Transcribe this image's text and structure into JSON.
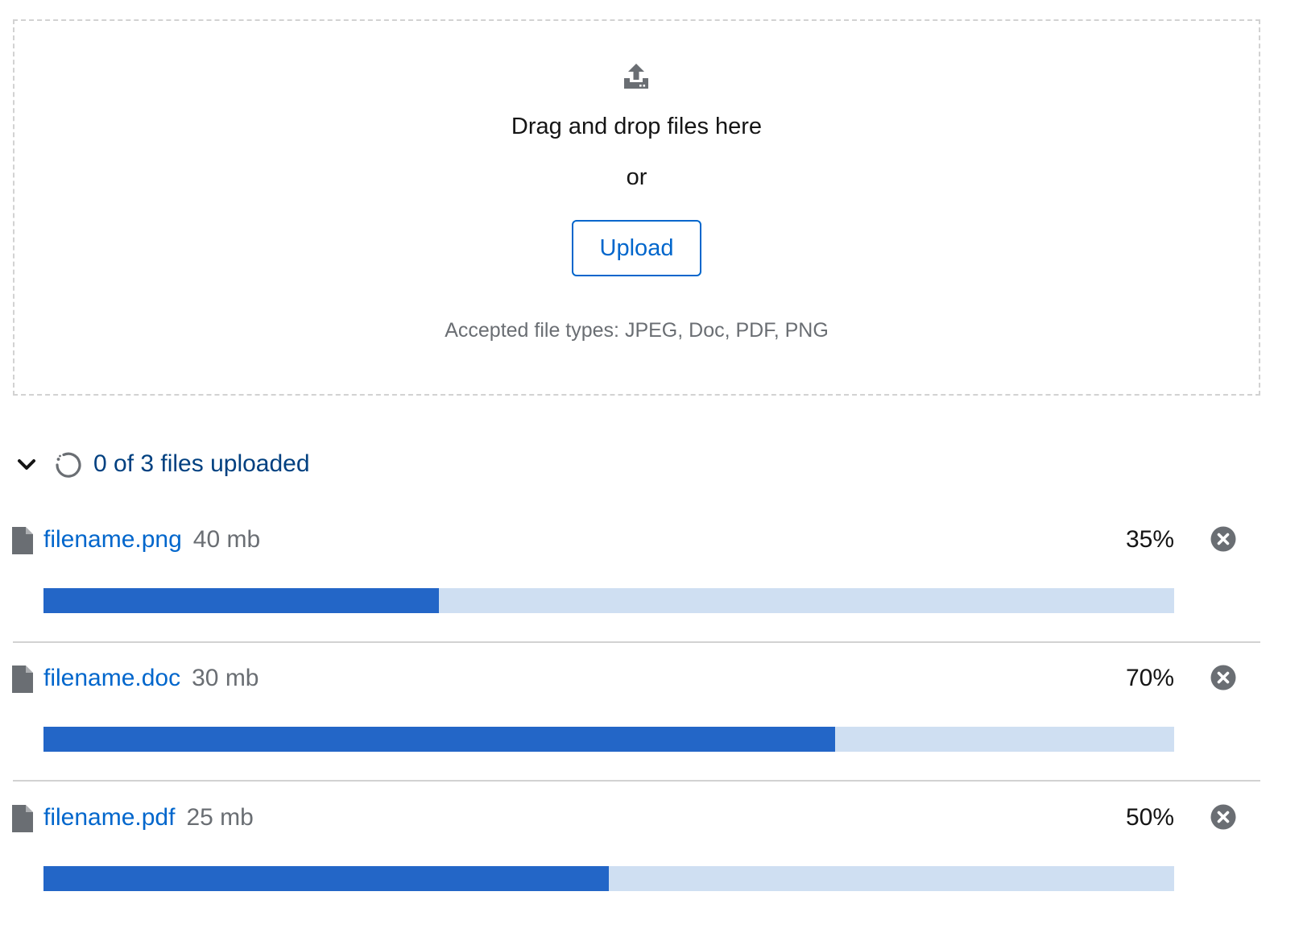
{
  "dropzone": {
    "icon": "upload-icon",
    "title": "Drag and drop files here",
    "or_text": "or",
    "upload_label": "Upload",
    "accepted_types": "Accepted file types: JPEG, Doc, PDF, PNG"
  },
  "status": {
    "toggle_icon": "chevron-down-icon",
    "spinner_icon": "in-progress-icon",
    "text": "0 of 3 files uploaded"
  },
  "files": [
    {
      "name": "filename.png",
      "size": "40 mb",
      "percent_label": "35%",
      "progress": 35
    },
    {
      "name": "filename.doc",
      "size": "30 mb",
      "percent_label": "70%",
      "progress": 70
    },
    {
      "name": "filename.pdf",
      "size": "25 mb",
      "percent_label": "50%",
      "progress": 50
    }
  ],
  "colors": {
    "link": "#0066cc",
    "status_text": "#004080",
    "progress_fill": "#2366c7",
    "progress_track": "#cfdff2",
    "icon_gray": "#6a6e73"
  }
}
